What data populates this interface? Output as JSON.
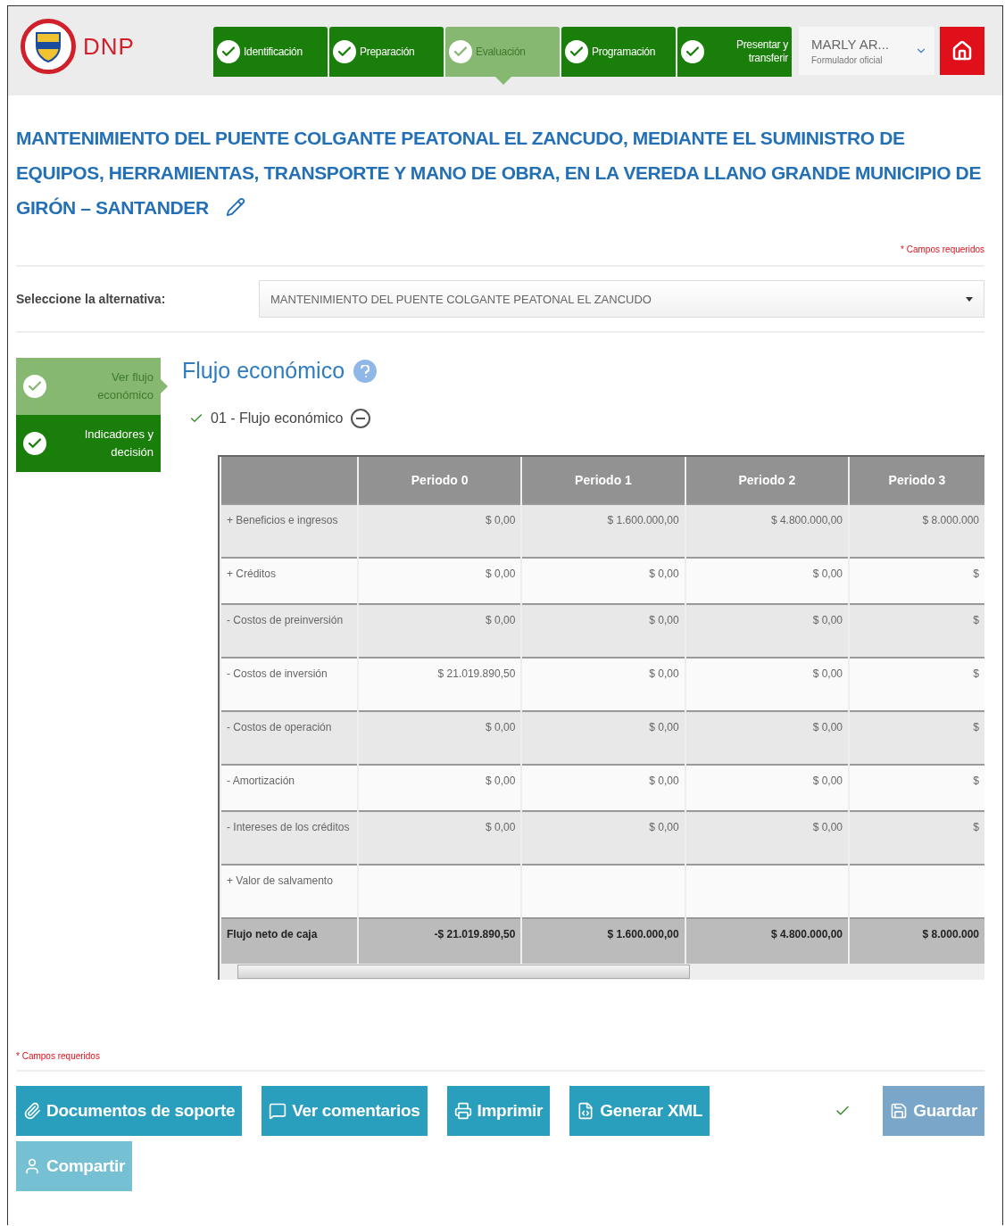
{
  "header": {
    "logo_text": "DNP",
    "steps": [
      {
        "label": "Identificación",
        "selected": false
      },
      {
        "label": "Preparación",
        "selected": false
      },
      {
        "label": "Evaluación",
        "selected": true
      },
      {
        "label": "Programación",
        "selected": false
      },
      {
        "label": "Presentar y transferir",
        "selected": false
      }
    ],
    "user": {
      "name": "MARLY AR...",
      "role": "Formulador oficial"
    }
  },
  "title": "MANTENIMIENTO DEL PUENTE COLGANTE PEATONAL EL ZANCUDO, MEDIANTE EL SUMINISTRO DE EQUIPOS, HERRAMIENTAS, TRANSPORTE Y MANO DE OBRA, EN LA VEREDA LLANO GRANDE MUNICIPIO DE GIRÓN – SANTANDER",
  "required_note_top": "* Campos requeridos",
  "alternative": {
    "label": "Seleccione la alternativa:",
    "value": "MANTENIMIENTO DEL PUENTE COLGANTE PEATONAL EL ZANCUDO"
  },
  "side_steps": [
    {
      "label": "Ver flujo económico",
      "selected": true
    },
    {
      "label": "Indicadores y decisión",
      "selected": false
    }
  ],
  "section_title": "Flujo económico",
  "subsection": "01 - Flujo económico",
  "table": {
    "columns": [
      "",
      "Periodo 0",
      "Periodo 1",
      "Periodo 2",
      "Periodo 3"
    ],
    "rows": [
      {
        "kind": "item",
        "cells": [
          "+ Beneficios e ingresos",
          "$ 0,00",
          "$ 1.600.000,00",
          "$ 4.800.000,00",
          "$ 8.000.000"
        ]
      },
      {
        "kind": "item",
        "cells": [
          "+ Créditos",
          "$ 0,00",
          "$ 0,00",
          "$ 0,00",
          "$"
        ]
      },
      {
        "kind": "item",
        "cells": [
          "- Costos de preinversión",
          "$ 0,00",
          "$ 0,00",
          "$ 0,00",
          "$"
        ]
      },
      {
        "kind": "item",
        "cells": [
          "- Costos de inversión",
          "$ 21.019.890,50",
          "$ 0,00",
          "$ 0,00",
          "$"
        ]
      },
      {
        "kind": "item",
        "cells": [
          "- Costos de operación",
          "$ 0,00",
          "$ 0,00",
          "$ 0,00",
          "$"
        ]
      },
      {
        "kind": "item",
        "cells": [
          "- Amortización",
          "$ 0,00",
          "$ 0,00",
          "$ 0,00",
          "$"
        ]
      },
      {
        "kind": "item",
        "cells": [
          "- Intereses de los créditos",
          "$ 0,00",
          "$ 0,00",
          "$ 0,00",
          "$"
        ]
      },
      {
        "kind": "item",
        "cells": [
          "+ Valor de salvamento",
          "",
          "",
          "",
          ""
        ]
      },
      {
        "kind": "total",
        "cells": [
          "Flujo neto de caja",
          "-$ 21.019.890,50",
          "$ 1.600.000,00",
          "$ 4.800.000,00",
          "$ 8.000.000"
        ]
      }
    ]
  },
  "required_note_bottom": "* Campos requeridos",
  "buttons": [
    {
      "label": "Documentos de soporte",
      "disabled": false
    },
    {
      "label": "Ver comentarios",
      "disabled": false
    },
    {
      "label": "Imprimir",
      "disabled": false
    },
    {
      "label": "Generar XML",
      "disabled": false
    },
    {
      "label": "Guardar",
      "disabled": true
    },
    {
      "label": "Compartir",
      "disabled": true
    }
  ]
}
